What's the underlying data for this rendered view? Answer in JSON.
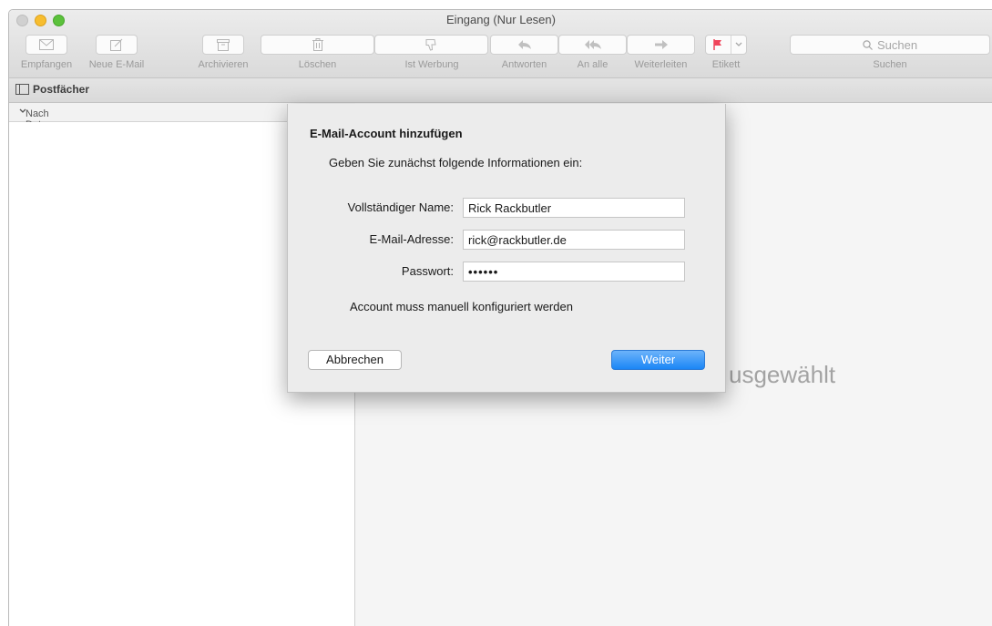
{
  "window": {
    "title": "Eingang (Nur Lesen)"
  },
  "toolbar": {
    "receive": "Empfangen",
    "new_mail": "Neue E-Mail",
    "archive": "Archivieren",
    "delete": "Löschen",
    "junk": "Ist Werbung",
    "reply": "Antworten",
    "reply_all": "An alle",
    "forward": "Weiterleiten",
    "flag": "Etikett",
    "search_placeholder": "Suchen",
    "search_label": "Suchen"
  },
  "favorites": {
    "mailboxes": "Postfächer"
  },
  "list": {
    "sort_label": "Nach Datum sortieren"
  },
  "viewer": {
    "no_selection_partial": "usgewählt"
  },
  "dialog": {
    "title": "E-Mail-Account hinzufügen",
    "subtitle": "Geben Sie zunächst folgende Informationen ein:",
    "name_label": "Vollständiger Name:",
    "name_value": "Rick Rackbutler",
    "email_label": "E-Mail-Adresse:",
    "email_value": "rick@rackbutler.de",
    "password_label": "Passwort:",
    "password_value": "••••••",
    "note": "Account muss manuell konfiguriert werden",
    "cancel": "Abbrechen",
    "next": "Weiter"
  },
  "colors": {
    "accent": "#1b86f6",
    "flag": "#f0445a"
  }
}
